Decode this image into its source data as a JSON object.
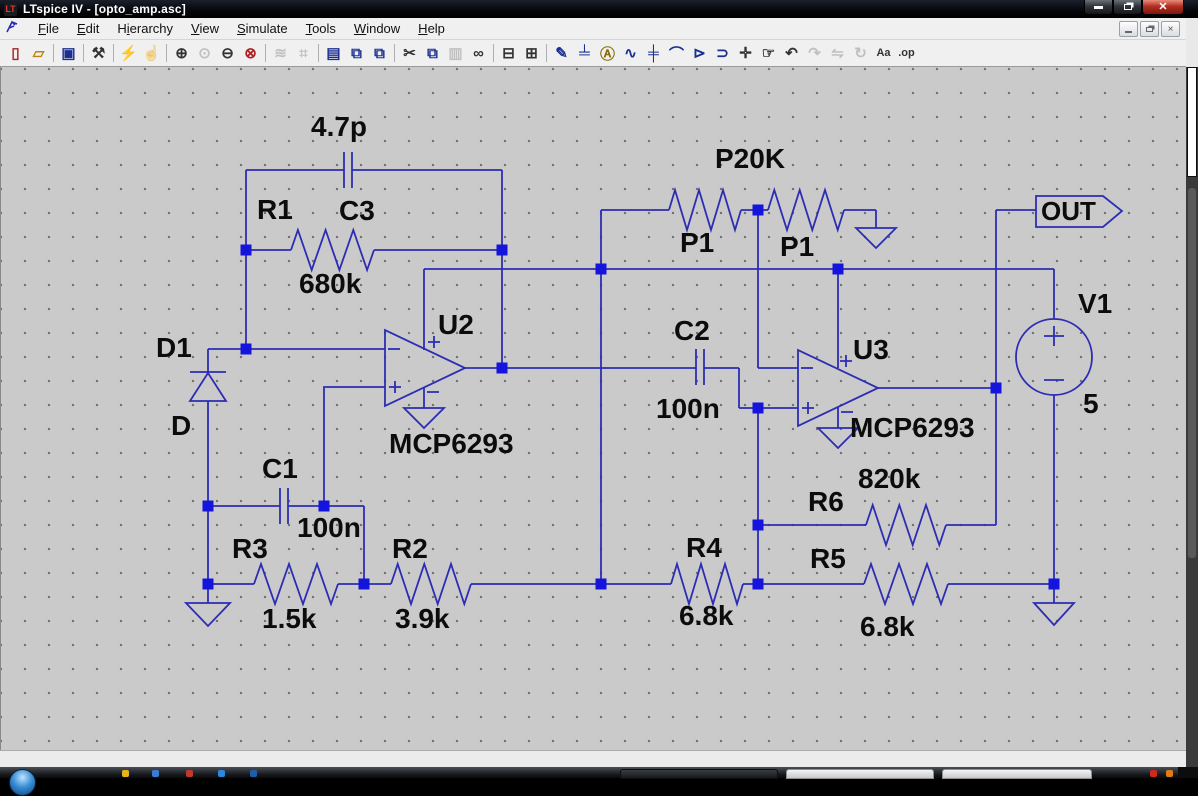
{
  "window": {
    "title": "LTspice IV - [opto_amp.asc]"
  },
  "menu": {
    "items": [
      {
        "name": "menu-file",
        "label": "File",
        "underline": 0
      },
      {
        "name": "menu-edit",
        "label": "Edit",
        "underline": 0
      },
      {
        "name": "menu-hierarchy",
        "label": "Hierarchy",
        "underline": 1
      },
      {
        "name": "menu-view",
        "label": "View",
        "underline": 0
      },
      {
        "name": "menu-simulate",
        "label": "Simulate",
        "underline": 0
      },
      {
        "name": "menu-tools",
        "label": "Tools",
        "underline": 0
      },
      {
        "name": "menu-window",
        "label": "Window",
        "underline": 0
      },
      {
        "name": "menu-help",
        "label": "Help",
        "underline": 0
      }
    ]
  },
  "toolbar": {
    "items": [
      {
        "name": "new-schematic-button",
        "glyph": "▯",
        "color": "#aa2222"
      },
      {
        "name": "open-file-button",
        "glyph": "▱",
        "color": "#b8860b"
      },
      {
        "type": "sep"
      },
      {
        "name": "save-button",
        "glyph": "▣",
        "color": "#1a2f8f"
      },
      {
        "type": "sep"
      },
      {
        "name": "control-panel-button",
        "glyph": "⚒",
        "color": "#333333"
      },
      {
        "type": "sep"
      },
      {
        "name": "run-button",
        "glyph": "⚡",
        "color": "#333333"
      },
      {
        "name": "halt-button",
        "glyph": "☝",
        "color": "#666666",
        "enabled": false
      },
      {
        "type": "sep"
      },
      {
        "name": "zoom-in-button",
        "glyph": "⊕",
        "color": "#333333"
      },
      {
        "name": "zoom-back-button",
        "glyph": "⊙",
        "color": "#888888",
        "enabled": false
      },
      {
        "name": "zoom-out-button",
        "glyph": "⊖",
        "color": "#333333"
      },
      {
        "name": "zoom-full-extents-button",
        "glyph": "⊗",
        "color": "#aa2222"
      },
      {
        "type": "sep"
      },
      {
        "name": "autorange-y-button",
        "glyph": "≋",
        "color": "#888888",
        "enabled": false
      },
      {
        "name": "zoom-pan-button",
        "glyph": "⌗",
        "color": "#888888",
        "enabled": false
      },
      {
        "type": "sep"
      },
      {
        "name": "tile-horizontal-button",
        "glyph": "▤",
        "color": "#1a2f8f"
      },
      {
        "name": "tile-vertical-button",
        "glyph": "⧉",
        "color": "#1a2f8f"
      },
      {
        "name": "cascade-windows-button",
        "glyph": "⧉",
        "color": "#1a2f8f"
      },
      {
        "type": "sep"
      },
      {
        "name": "cut-button",
        "glyph": "✂",
        "color": "#333333"
      },
      {
        "name": "copy-button",
        "glyph": "⧉",
        "color": "#1a2f8f"
      },
      {
        "name": "paste-button",
        "glyph": "▥",
        "color": "#888888",
        "enabled": false
      },
      {
        "name": "find-button",
        "glyph": "∞",
        "color": "#333333"
      },
      {
        "type": "sep"
      },
      {
        "name": "print-button",
        "glyph": "⊟",
        "color": "#333333"
      },
      {
        "name": "print-preview-button",
        "glyph": "⊞",
        "color": "#333333"
      },
      {
        "type": "sep"
      },
      {
        "name": "draw-wire-button",
        "glyph": "✎",
        "color": "#1a2f8f"
      },
      {
        "name": "place-ground-button",
        "glyph": "╧",
        "color": "#1a2f8f"
      },
      {
        "name": "place-label-button",
        "glyph": "Ⓐ",
        "color": "#8a6d00"
      },
      {
        "name": "place-resistor-button",
        "glyph": "∿",
        "color": "#1a2f8f"
      },
      {
        "name": "place-capacitor-button",
        "glyph": "╪",
        "color": "#1a2f8f"
      },
      {
        "name": "place-inductor-button",
        "glyph": "⌒",
        "color": "#1a2f8f"
      },
      {
        "name": "place-diode-button",
        "glyph": "⊳",
        "color": "#1a2f8f"
      },
      {
        "name": "place-component-button",
        "glyph": "⊃",
        "color": "#1a2f8f"
      },
      {
        "name": "move-button",
        "glyph": "✛",
        "color": "#333333"
      },
      {
        "name": "drag-button",
        "glyph": "☞",
        "color": "#333333"
      },
      {
        "name": "undo-button",
        "glyph": "↶",
        "color": "#333333"
      },
      {
        "name": "redo-button",
        "glyph": "↷",
        "color": "#888888",
        "enabled": false
      },
      {
        "name": "mirror-button",
        "glyph": "⇋",
        "color": "#888888",
        "enabled": false
      },
      {
        "name": "rotate-button",
        "glyph": "↻",
        "color": "#888888",
        "enabled": false
      },
      {
        "name": "text-button",
        "glyph": "Aa",
        "color": "#333333",
        "small": true
      },
      {
        "name": "spice-directive-button",
        "glyph": ".op",
        "color": "#333333",
        "small": true
      }
    ]
  },
  "schematic": {
    "c3": {
      "ref": "C3",
      "value": "4.7p"
    },
    "r1": {
      "ref": "R1",
      "value": "680k"
    },
    "pot": {
      "value": "P20K",
      "left_ref": "P1",
      "right_ref": "P1"
    },
    "out_flag": {
      "label": "OUT"
    },
    "d1": {
      "ref": "D1",
      "value": "D"
    },
    "u2": {
      "ref": "U2",
      "value": "MCP6293"
    },
    "u3": {
      "ref": "U3",
      "value": "MCP6293"
    },
    "c1": {
      "ref": "C1",
      "value": "100n"
    },
    "c2": {
      "ref": "C2",
      "value": "100n"
    },
    "r2": {
      "ref": "R2",
      "value": "3.9k"
    },
    "r3": {
      "ref": "R3",
      "value": "1.5k"
    },
    "r4": {
      "ref": "R4",
      "value": "6.8k"
    },
    "r5": {
      "ref": "R5",
      "value": "6.8k"
    },
    "r6": {
      "ref": "R6",
      "value": "820k"
    },
    "v1": {
      "ref": "V1",
      "value": "5"
    }
  },
  "colors": {
    "wire_blue": "#2d2db4",
    "junction_blue": "#1414dc",
    "canvas_gray": "#cacaca",
    "label_black": "#0c0c0c"
  }
}
